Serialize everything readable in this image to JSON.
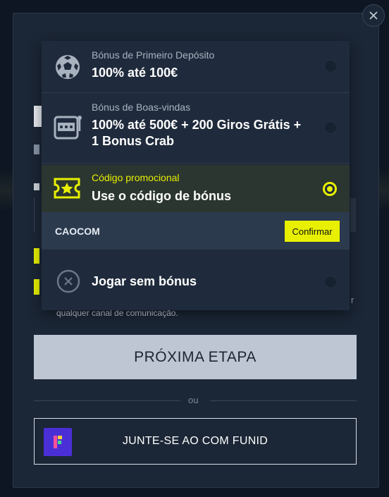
{
  "bonus_options": [
    {
      "label": "Bónus de Primeiro Depósito",
      "title": "100% até 100€",
      "icon": "soccer-ball-icon",
      "selected": false
    },
    {
      "label": "Bónus de Boas-vindas",
      "title": "100% até 500€ + 200 Giros Grátis + 1 Bonus Crab",
      "icon": "slot-machine-icon",
      "selected": false
    },
    {
      "label": "Código promocional",
      "title": "Use o código de bónus",
      "icon": "ticket-star-icon",
      "selected": true
    },
    {
      "title": "Jogar sem bónus",
      "icon": "close-circle-icon",
      "selected": false
    }
  ],
  "promo": {
    "code": "CAOCOM",
    "confirm_label": "Confirmar"
  },
  "consent_text": "qualquer canal de comunicação.",
  "next_button_label": "PRÓXIMA ETAPA",
  "or_label": "ou",
  "funid_button_label": "JUNTE-SE AO COM FUNID",
  "colors": {
    "accent": "#e8f000",
    "modal_bg": "#1b2636",
    "page_bg": "#0d1622"
  }
}
